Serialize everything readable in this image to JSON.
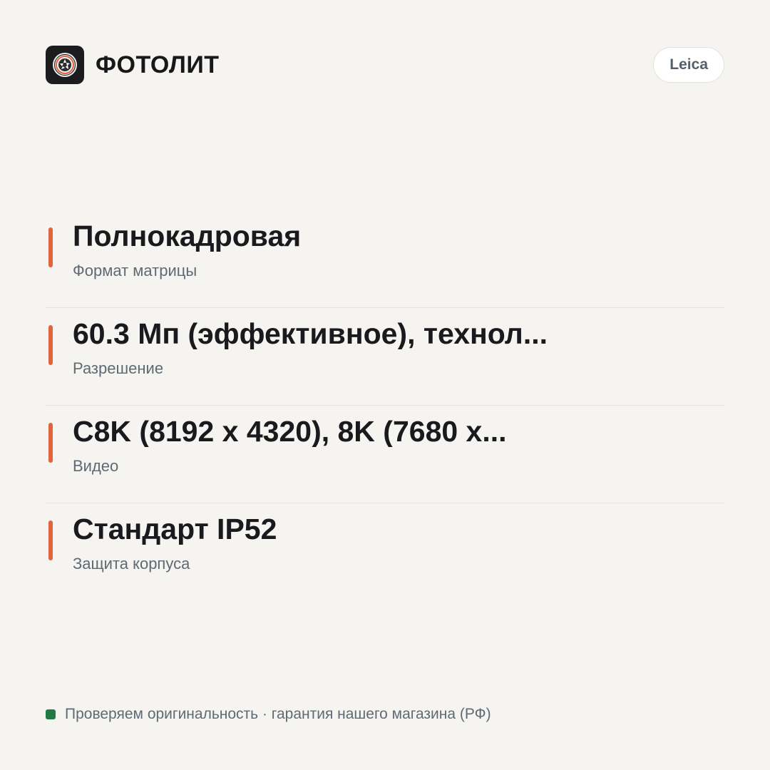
{
  "header": {
    "brand_name": "ФОТОЛИТ",
    "logo_icon": "camera-aperture-icon",
    "brand_tag": "Leica"
  },
  "specs": [
    {
      "value": "Полнокадровая",
      "label": "Формат матрицы"
    },
    {
      "value": "60.3 Мп (эффективное), технол...",
      "label": "Разрешение"
    },
    {
      "value": "C8K (8192 x 4320), 8K (7680 x...",
      "label": "Видео"
    },
    {
      "value": "Стандарт IP52",
      "label": "Защита корпуса"
    }
  ],
  "footer": {
    "text": "Проверяем оригинальность · гарантия нашего магазина (РФ)",
    "status_color": "#1f7a45"
  },
  "colors": {
    "accent": "#e2643e",
    "background": "#f5f4f0"
  }
}
